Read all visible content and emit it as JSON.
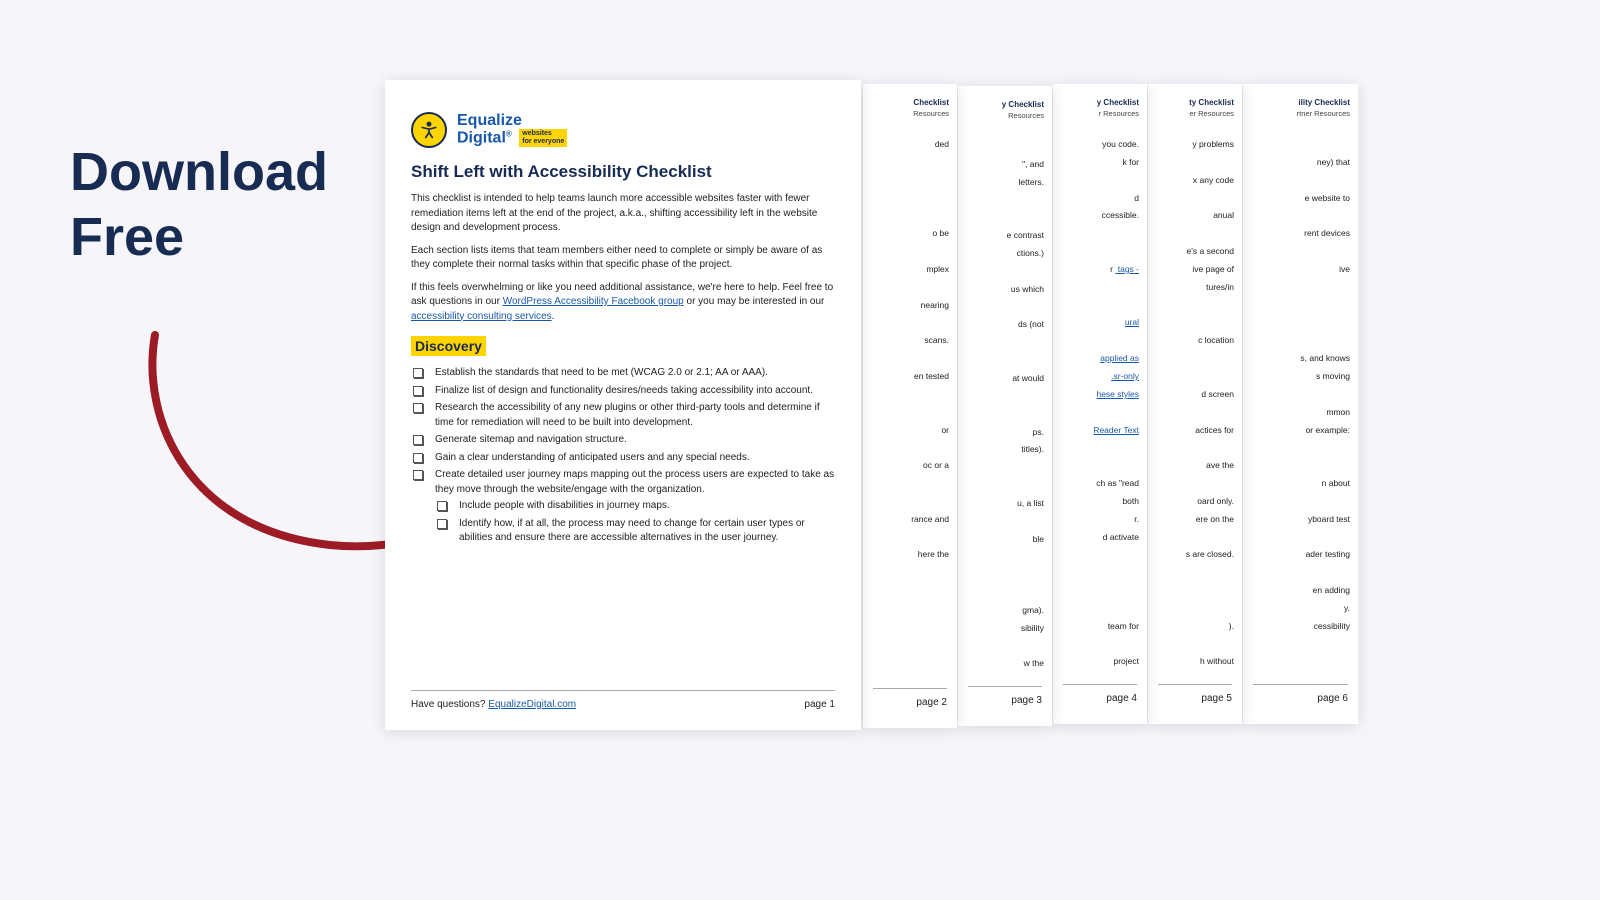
{
  "cta": {
    "line1": "Download",
    "line2": "Free"
  },
  "logo": {
    "top": "Equalize",
    "bot": "Digital",
    "sup": "®",
    "tag_l1": "websites",
    "tag_l2": "for everyone",
    "icon": "accessibility-person-icon"
  },
  "doc": {
    "title": "Shift Left with Accessibility Checklist",
    "intro1": "This checklist is intended to help teams launch more accessible websites faster with fewer remediation items left at the end of the project, a.k.a., shifting accessibility left in the website design and development process.",
    "intro2": "Each section lists items that team members either need to complete or simply be aware of as they complete their normal tasks within that specific phase of the project.",
    "intro3_pre": "If this feels overwhelming or like you need additional assistance, we're here to help. Feel free to ask questions in our ",
    "intro3_link1": "WordPress Accessibility Facebook group",
    "intro3_mid": " or you may be interested in our ",
    "intro3_link2": "accessibility consulting services",
    "intro3_post": ".",
    "section": "Discovery",
    "items": [
      "Establish the standards that need to be met (WCAG 2.0 or 2.1; AA or AAA).",
      "Finalize list of design and functionality desires/needs taking accessibility into account.",
      "Research the accessibility of any new plugins or other third-party tools and determine if time for remediation will need to be built into development.",
      "Generate sitemap and navigation structure.",
      "Gain a clear understanding of anticipated users and any special needs.",
      "Create detailed user journey maps mapping out the process users are expected to take as they move through the website/engage with the organization."
    ],
    "subitems": [
      "Include people with disabilities in journey maps.",
      "Identify how, if at all, the process may need to change for certain user types or abilities and ensure there are accessible alternatives in the user journey."
    ],
    "footer_q": "Have questions? ",
    "footer_link": "EqualizeDigital.com",
    "footer_page": "page 1"
  },
  "strips": [
    {
      "hdr": " Checklist",
      "sub": "Resources",
      "frags": [
        "ded",
        "",
        "",
        "",
        "",
        "o be",
        "",
        "mplex",
        "",
        "nearing",
        "",
        "scans.",
        "",
        "en tested",
        "",
        "",
        "or",
        "",
        "oc or a",
        "",
        "",
        "rance and",
        "",
        "here the"
      ],
      "page": "page 2"
    },
    {
      "hdr": "y Checklist",
      "sub": "Resources",
      "frags": [
        "",
        "\", and",
        "letters.",
        "",
        "",
        "e contrast",
        "ctions.)",
        "",
        "us which",
        "",
        "ds (not",
        "",
        "",
        "at would",
        "",
        "",
        "ps.",
        "titles).",
        "",
        "",
        "u, a list",
        "",
        "ble",
        "",
        "",
        "",
        "gma).",
        "sibility",
        "",
        "w the"
      ],
      "page": "page 3"
    },
    {
      "hdr": "y Checklist",
      "sub": "r Resources",
      "frags": [
        "you code.",
        "k for",
        "",
        "d",
        "ccessible.",
        "",
        "",
        "r <a> tags -",
        "",
        "",
        "ural",
        "",
        "applied as",
        ".sr-only",
        "hese styles",
        "",
        "Reader Text",
        "",
        "",
        "ch as \"read",
        "both",
        "r.",
        "d activate",
        "",
        "",
        "",
        "",
        "team for",
        "",
        "project"
      ],
      "page": "page 4",
      "link_idx": 16
    },
    {
      "hdr": "ty Checklist",
      "sub": "er Resources",
      "frags": [
        "y problems",
        "",
        "x any code",
        "",
        "anual",
        "",
        "e's a second",
        "ive page of",
        "tures/in",
        "",
        "",
        "c location",
        "",
        "",
        "d screen",
        "",
        "actices for",
        "",
        "ave the",
        "",
        "oard only.",
        "ere on the",
        "",
        "s are closed.",
        "",
        "",
        "",
        ").",
        "",
        "h without"
      ],
      "page": "page 5"
    },
    {
      "hdr": "ility Checklist",
      "sub": "rtner Resources",
      "frags": [
        "",
        "ney) that",
        "",
        "e website to",
        "",
        "rent devices",
        "",
        "ive",
        "",
        "",
        "",
        "",
        "s, and knows",
        "s moving",
        "",
        "mmon",
        "or example:",
        "",
        "",
        "n about",
        "",
        "yboard test",
        "",
        "ader testing",
        "",
        "en adding",
        "y.",
        "cessibility"
      ],
      "page": "page 6"
    }
  ]
}
